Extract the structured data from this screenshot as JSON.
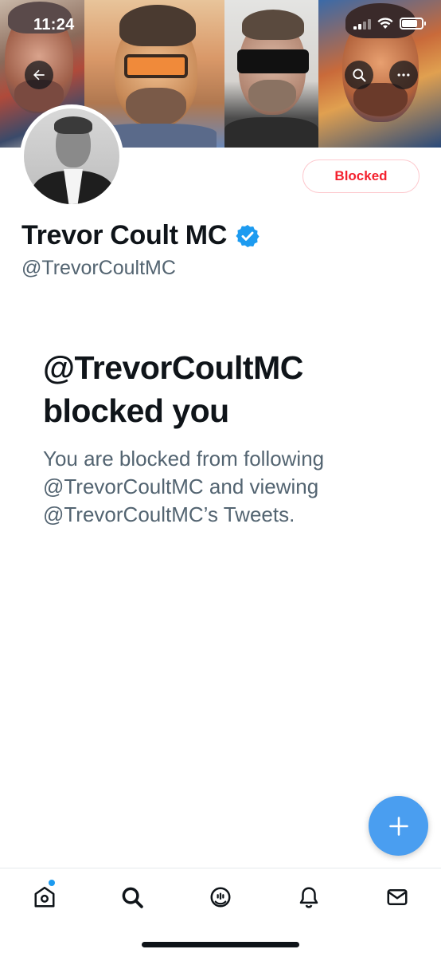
{
  "status_bar": {
    "time": "11:24"
  },
  "banner": {
    "back_icon": "arrow-left-icon",
    "search_icon": "search-icon",
    "more_icon": "more-horizontal-icon"
  },
  "profile": {
    "display_name": "Trevor Coult MC",
    "handle": "@TrevorCoultMC",
    "verified": true,
    "blocked_button_label": "Blocked"
  },
  "blocked_notice": {
    "title_line1": "@TrevorCoultMC",
    "title_line2": "blocked you",
    "description": "You are blocked from following @TrevorCoultMC and viewing @TrevorCoultMC’s Tweets."
  },
  "compose": {
    "icon": "plus-icon"
  },
  "bottom_nav": {
    "items": [
      {
        "id": "home",
        "icon": "home-icon",
        "has_dot": true
      },
      {
        "id": "search",
        "icon": "search-icon"
      },
      {
        "id": "spaces",
        "icon": "spaces-icon"
      },
      {
        "id": "notifications",
        "icon": "bell-icon"
      },
      {
        "id": "messages",
        "icon": "mail-icon"
      }
    ]
  },
  "colors": {
    "accent": "#1d9bf0",
    "fab": "#4a9ef0",
    "blocked_red": "#f4212e",
    "secondary_text": "#536471",
    "primary_text": "#0f1419"
  }
}
